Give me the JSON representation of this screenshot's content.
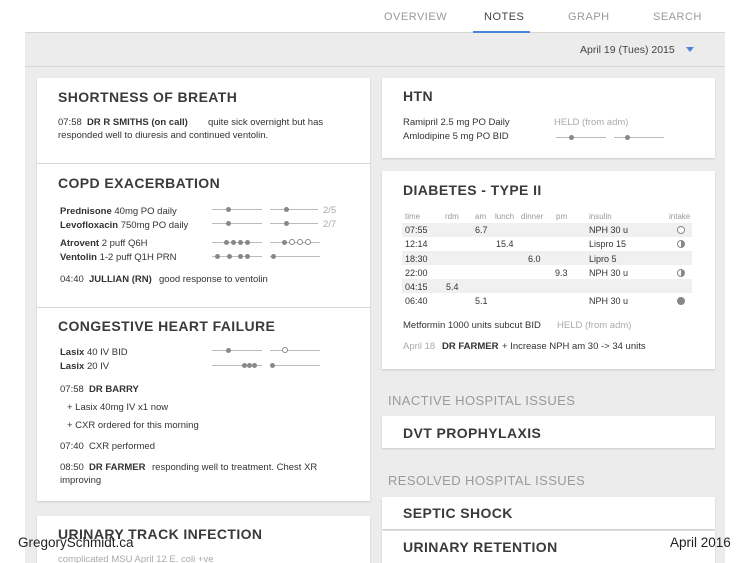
{
  "tabs": [
    "OVERVIEW",
    "NOTES",
    "GRAPH",
    "SEARCH"
  ],
  "date": "April 19  (Tues)  2015",
  "sob": {
    "title": "SHORTNESS OF BREATH",
    "time": "07:58",
    "author": "DR R SMITHS (on call)",
    "note1": "quite sick overnight but has",
    "note2": "responded well to diuresis and continued ventolin."
  },
  "copd": {
    "title": "COPD EXACERBATION",
    "meds": [
      {
        "name": "Prednisone",
        "dose": "40mg PO daily",
        "frac": "2/5"
      },
      {
        "name": "Levofloxacin",
        "dose": "750mg PO daily",
        "frac": "2/7"
      },
      {
        "name": "Atrovent",
        "dose": "2 puff Q6H"
      },
      {
        "name": "Ventolin",
        "dose": "1-2 puff Q1H PRN"
      }
    ],
    "time": "04:40",
    "author": "JULLIAN (RN)",
    "note": "good response to ventolin"
  },
  "chf": {
    "title": "CONGESTIVE HEART FAILURE",
    "meds": [
      {
        "name": "Lasix",
        "dose": "40 IV BID"
      },
      {
        "name": "Lasix",
        "dose": "20 IV"
      }
    ],
    "n1_time": "07:58",
    "n1_author": "DR BARRY",
    "n1_l1": "+ Lasix 40mg IV x1 now",
    "n1_l2": "+ CXR ordered for this morning",
    "n2_time": "07:40",
    "n2_text": "CXR performed",
    "n3_time": "08:50",
    "n3_author": "DR FARMER",
    "n3_l1": "responding well to treatment. Chest XR",
    "n3_l2": "improving"
  },
  "uti": {
    "title": "URINARY TRACK INFECTION",
    "note": "complicated   MSU April 12 E. coli +ve"
  },
  "htn": {
    "title": "HTN",
    "med1": "Ramipril 2.5 mg PO Daily",
    "med2": "Amlodipine 5 mg PO BID",
    "held": "HELD (from adm)"
  },
  "diabetes": {
    "title": "DIABETES - TYPE II",
    "headers": [
      "time",
      "rdm",
      "am",
      "lunch",
      "dinner",
      "pm",
      "insulin",
      "intake"
    ],
    "rows": [
      [
        "07:55",
        "",
        "6.7",
        "",
        "",
        "",
        "NPH 30 u"
      ],
      [
        "12:14",
        "",
        "",
        "15.4",
        "",
        "",
        "Lispro 15"
      ],
      [
        "18:30",
        "",
        "",
        "",
        "6.0",
        "",
        "Lipro 5"
      ],
      [
        "22:00",
        "",
        "",
        "",
        "",
        "9.3",
        "NPH 30 u"
      ],
      [
        "04:15",
        "5.4",
        "",
        "",
        "",
        "",
        ""
      ],
      [
        "06:40",
        "",
        "5.1",
        "",
        "",
        "",
        "NPH 30 u"
      ]
    ],
    "metformin": "Metformin 1000 units subcut BID",
    "held": "HELD (from adm)",
    "n_date": "April 18",
    "n_author": "DR FARMER",
    "n_text": "+ Increase NPH am 30 -> 34 units"
  },
  "inactive_label": "INACTIVE HOSPITAL ISSUES",
  "dvt": "DVT PROPHYLAXIS",
  "resolved_label": "RESOLVED HOSPITAL ISSUES",
  "septic": "SEPTIC SHOCK",
  "retention": "URINARY RETENTION",
  "watermark_left": "GregorySchmidt.ca",
  "watermark_right": "April 2016",
  "colors": {
    "accent": "#4a86d8",
    "background": "#ececec"
  }
}
